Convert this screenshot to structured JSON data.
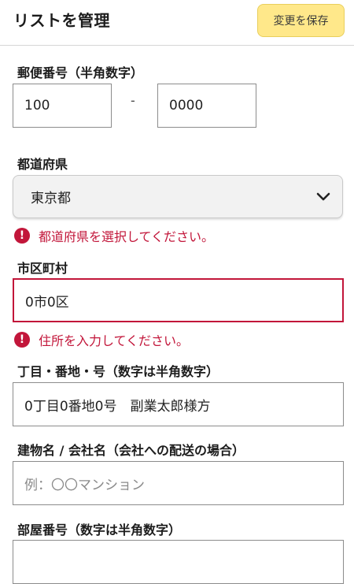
{
  "header": {
    "title": "リストを管理",
    "save_label": "変更を保存"
  },
  "postal": {
    "label": "郵便番号（半角数字）",
    "first_value": "100",
    "separator": "-",
    "second_value": "0000"
  },
  "prefecture": {
    "label": "都道府県",
    "selected": "東京都",
    "error": "都道府県を選択してください。"
  },
  "city": {
    "label": "市区町村",
    "value": "0市0区",
    "error": "住所を入力してください。"
  },
  "street": {
    "label": "丁目・番地・号（数字は半角数字）",
    "value": "0丁目0番地0号　副業太郎様方"
  },
  "building": {
    "label": "建物名 / 会社名（会社への配送の場合）",
    "placeholder": "例：〇〇マンション"
  },
  "room": {
    "label": "部屋番号（数字は半角数字）"
  },
  "colors": {
    "accent_button": "#ffe88a",
    "error": "#c2163a"
  },
  "icons": {
    "select_arrow": "chevron-down-icon",
    "error": "exclamation-circle-icon"
  }
}
